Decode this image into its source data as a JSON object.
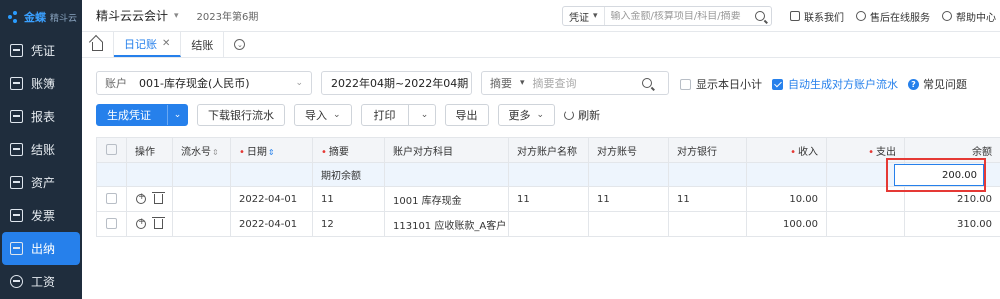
{
  "sidebar": {
    "brand": "金蝶",
    "brand_sub": "精斗云",
    "items": [
      {
        "label": "凭证",
        "icon": "voucher-icon"
      },
      {
        "label": "账簿",
        "icon": "ledger-icon"
      },
      {
        "label": "报表",
        "icon": "report-icon"
      },
      {
        "label": "结账",
        "icon": "closing-icon"
      },
      {
        "label": "资产",
        "icon": "asset-icon"
      },
      {
        "label": "发票",
        "icon": "invoice-icon"
      },
      {
        "label": "出纳",
        "icon": "cashier-icon",
        "active": true
      },
      {
        "label": "工资",
        "icon": "salary-icon"
      }
    ]
  },
  "topbar": {
    "app_name": "精斗云云会计",
    "period": "2023年第6期",
    "search_type": "凭证",
    "search_placeholder": "输入金额/核算项目/科目/摘要",
    "links": [
      "联系我们",
      "售后在线服务",
      "帮助中心"
    ]
  },
  "tabs": [
    {
      "label": "日记账",
      "active": true
    },
    {
      "label": "结账",
      "active": false
    }
  ],
  "filters": {
    "account_label": "账户",
    "account_value": "001-库存现金(人民币)",
    "period_value": "2022年04期~2022年04期",
    "summary_label": "摘要",
    "summary_placeholder": "摘要查询",
    "show_daily_subtotal": "显示本日小计",
    "auto_generate": "自动生成对方账户流水",
    "faq": "常见问题"
  },
  "toolbar": {
    "generate_voucher": "生成凭证",
    "download_statement": "下载银行流水",
    "import": "导入",
    "print": "打印",
    "export": "导出",
    "more": "更多",
    "refresh": "刷新"
  },
  "table": {
    "headers": [
      "操作",
      "流水号",
      "日期",
      "摘要",
      "账户对方科目",
      "对方账户名称",
      "对方账号",
      "对方银行",
      "收入",
      "支出",
      "余额"
    ],
    "opening_label": "期初余额",
    "opening_balance": "200.00",
    "rows": [
      {
        "date": "2022-04-01",
        "summary": "11",
        "subject": "1001 库存现金",
        "cp_name": "11",
        "cp_account": "11",
        "cp_bank": "11",
        "income": "10.00",
        "expense": "",
        "balance": "210.00"
      },
      {
        "date": "2022-04-01",
        "summary": "12",
        "subject": "113101 应收账款_A客户",
        "cp_name": "",
        "cp_account": "",
        "cp_bank": "",
        "income": "100.00",
        "expense": "",
        "balance": "310.00"
      }
    ]
  },
  "colors": {
    "accent": "#2680eb",
    "sidebar": "#1f2d3d",
    "highlight": "#e53935"
  }
}
